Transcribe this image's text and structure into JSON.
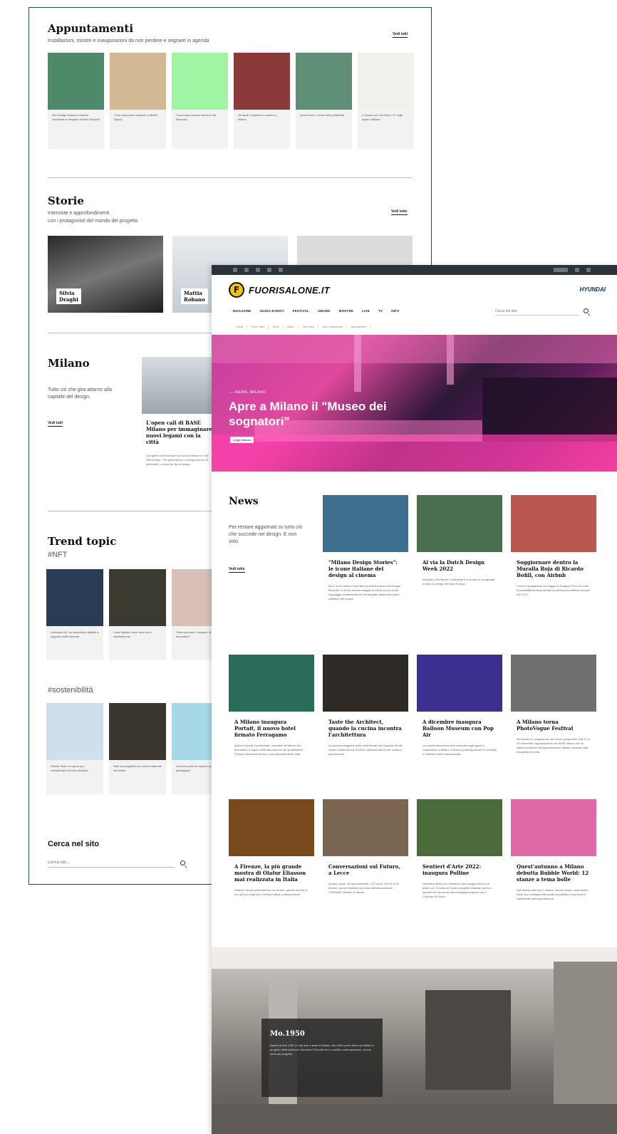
{
  "back_page": {
    "appuntamenti": {
      "title": "Appuntamenti",
      "subtitle": "Installazioni, mostre e inaugurazioni da non perdere e segnare in agenda",
      "see_all": "Vedi tutti",
      "cards": [
        {
          "caption": "ADI Design Museum celebra l'architetto e designer Alberto Rosselli",
          "color": "#4e8a6a"
        },
        {
          "caption": "Tutto sulla prima edizione di BASE Napoli",
          "color": "#d3b896"
        },
        {
          "caption": "Come sarà la terza edizione del Biennale",
          "color": "#9ff5a4"
        },
        {
          "caption": "Gli studi di plastica in mostra a Milano",
          "color": "#8a3a38"
        },
        {
          "caption": "Quanti sono I Voxel della pubblicità",
          "color": "#5f8f77"
        },
        {
          "caption": "Il Sonda con Cini Boeri: 22 negli spazi a Milano",
          "color": "#f2f0ea"
        }
      ]
    },
    "storie": {
      "title": "Storie",
      "subtitle_line1": "Interviste e approfondimenti",
      "subtitle_line2": "con i protagonisti del mondo del progetto",
      "see_all": "Vedi tutte",
      "people": [
        {
          "name": "Silvia\nDraghi"
        },
        {
          "name": "Mattia\nRobano"
        }
      ]
    },
    "milano": {
      "title": "Milano",
      "description": "Tutto ciò che gira attorno alla capitale del design.",
      "see_all": "Vedi tutti",
      "article_title": "L'open call di BASE Milano per immaginare nuovi legami con la città",
      "article_desc": "Il progetto si rinnova per la nuova edizione di \"We Will Design\". Per partecipare c'è tempo fino al 13 settembre, ci sono tre tipi di design."
    },
    "trend": {
      "title": "Trend topic",
      "tag1": "#NFT",
      "cards1": [
        {
          "caption": "Unframed Art, un laboratorio digitale a supporto delle aziende",
          "color": "#2a3b55"
        },
        {
          "caption": "L'arte digitale come deve per il cambiamento",
          "color": "#3a3a30"
        },
        {
          "caption": "Come pensare i designer di NFT e innovatori?",
          "color": "#d8c0b8"
        }
      ],
      "tag2": "#sostenibilità",
      "cards2": [
        {
          "caption": "Affinity Team: un gioco per comprendere la crisi climatica",
          "color": "#cfe0ec"
        },
        {
          "caption": "Nike ha progettato un nuovo materiale innovativo",
          "color": "#3b3530"
        },
        {
          "caption": "Occorre preferire quando preferire un packaging?",
          "color": "#a6d9e5"
        }
      ]
    },
    "search": {
      "title": "Cerca nel sito",
      "placeholder": "Cerca ser..."
    }
  },
  "front_page": {
    "logo_letter": "F",
    "logo_text": "FUORISALONE.IT",
    "sponsor": "HYUNDAI",
    "nav": [
      "MAGAZINE",
      "GUIDA EVENTI",
      "FESTIVAL",
      "AWARD",
      "MOSTRE",
      "LIVE",
      "TV",
      "INFO"
    ],
    "search_placeholder": "Cerca nel sito",
    "subnav": [
      "Home",
      "Primo Piano",
      "Storie",
      "Milano",
      "Trend topic",
      "Arte e Innovazione",
      "Appuntamenti"
    ],
    "hero": {
      "kicker": "— NEWS, MILANO",
      "title": "Apre a Milano il \"Museo dei sognatori\"",
      "cta": "Leggi l'articolo"
    },
    "news": {
      "title": "News",
      "description": "Per restare aggiornati su tutto ciò che succede nel design. E non solo.",
      "see_all": "Vedi tutte",
      "items": [
        {
          "title": "\"Milano Design Stories\": le icone italiane del design al cinema",
          "desc": "Dal 2 al 31 ottobre Dusk fatto presenti presso ADI Design Museum un breve cortometraggio di rivista sui punti del linguaggio contemporaneo del progetto attraverso opere collettive del museo.",
          "color": "#3f6f8f"
        },
        {
          "title": "Al via la Dutch Design Week 2022",
          "desc": "Insegna a Eindhoven il presente e a mostre le più grande mostre di design del Nord Europa.",
          "color": "#4b6e4f"
        },
        {
          "title": "Soggiornare dentro la Muralla Roja di Ricardo Bofill, con Airbnb",
          "desc": "Come si programma un viaggio in Spagna? Ecco la notte le possibilità di tanta all'interno dell'iconica edificio formato nel 1973.",
          "color": "#b8584e"
        },
        {
          "title": "A Milano inaugura Portait, il nuovo hotel firmato Ferragamo",
          "desc": "Aperto le porte il presentare i dormitori all'interno del monastero a regolo sede alla storiche del Quadrilatero. Cortina l'ambiente storico, nella splendida della città.",
          "color": "#2a6b5a"
        },
        {
          "title": "Taste the Architect, quando la cucina incontra l'architettura",
          "desc": "La seconda stagione della serie firmata da Squadra Studio rende a dinamica da STUDIO dedicata alla forme cucina e sperimentali.",
          "color": "#2f2a25"
        },
        {
          "title": "A dicembre inaugura Balloon Museum con Pop Air",
          "desc": "La mostra immersiva sarà costruita negli spazi di Superstudio a Milano e vedrà la partecipazione di 18 artisti e collettivi d'arte internazionali.",
          "color": "#3b2f8f"
        },
        {
          "title": "A Milano torna PhotoVogue Festival",
          "desc": "Sei mostre in programma, sei nuove prospettive. Dal 17 al 20 novembre l'appuntamento da BASE Milano con la settima edizione dell'appuntamento italiano dedicato alla fotografia di moda.",
          "color": "#6f7070"
        },
        {
          "title": "A Firenze, la più grande mostra di Olafur Eliasson mai realizzata in Italia",
          "desc": "Palazzo Strozzi presenta Nel tuo tempo, grande mostra di uno dei più originali e visionari artisti contemporanei.",
          "color": "#7a4a1f"
        },
        {
          "title": "Conversazioni sul Futuro, a Lecce",
          "desc": "Quattro giorni, 80 appuntamenti, 170 ospiti. Dal 20 al 23 ottobre, torna il festival promosso dall'associazione CIDRANE Edizioni di Salute.",
          "color": "#7a6650"
        },
        {
          "title": "Sentieri d'Arte 2022: inaugura Polline",
          "desc": "Valentina della Licio elemento alla inaugura Aldo si al parte ora. Si tratta del nostro progetto stradale con luci lanciati che lavora da alta montagna a Aprica con il Comune di Fonno.",
          "color": "#4b6b3a"
        },
        {
          "title": "Quest'autunno a Milano debutta Bubble World: 12 stanze a tema bolle",
          "desc": "Dall'ottobre alla fine 2 ottobre, Tonelli spazio, dall'esterno bene luce consapevole sociali possibilità e sicurezza le tradizionali della acquisizione.",
          "color": "#e06aa8"
        }
      ]
    },
    "showroom": {
      "title": "Mo.1950",
      "desc": "Aperta di inizi 1957 a Lodi arte e sede di Milano. Mo 1950 vuole offrire ad Milano il progetto della scelta di Camerani il Sonetti nel in vendita contemporaneo, di una sorta del progetto."
    }
  }
}
